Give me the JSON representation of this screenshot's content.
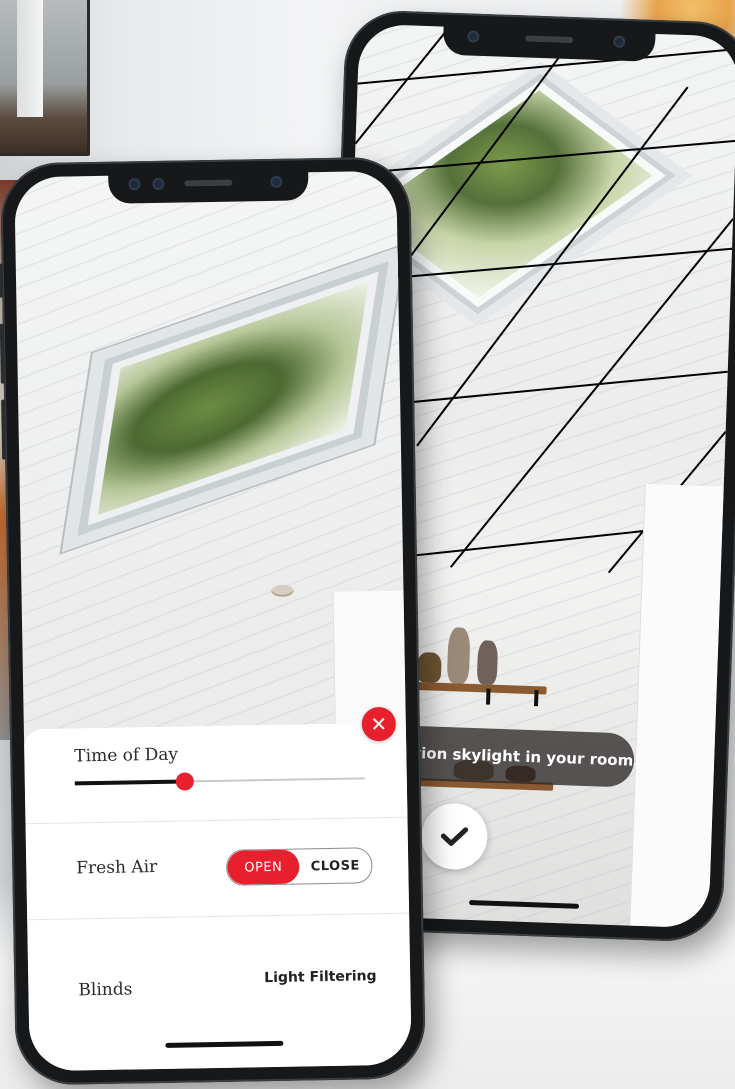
{
  "ar_view": {
    "instruction": "g to position skylight in your room."
  },
  "controls": {
    "time_of_day": {
      "label": "Time of Day",
      "value_fraction": 0.38
    },
    "fresh_air": {
      "label": "Fresh Air",
      "options": [
        "OPEN",
        "CLOSE"
      ],
      "selected": "OPEN"
    },
    "blinds": {
      "label": "Blinds",
      "value": "Light Filtering"
    }
  },
  "icons": {
    "close": "close-icon",
    "confirm": "checkmark-icon"
  },
  "colors": {
    "accent": "#e8202e",
    "pill_bg": "#2d2826",
    "phone_frame": "#16181a"
  }
}
